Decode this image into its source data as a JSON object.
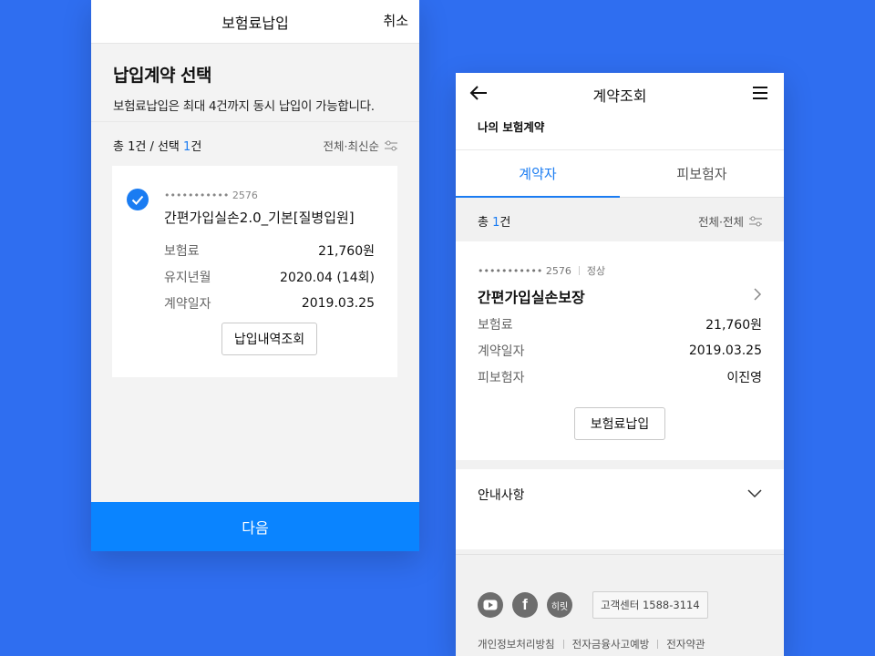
{
  "left": {
    "header_title": "보험료납입",
    "cancel_label": "취소",
    "heading": "납입계약 선택",
    "description": "보험료납입은 최대 4건까지 동시 납입이 가능합니다.",
    "count_prefix": "총 1건 / 선택 ",
    "count_selected": "1",
    "count_suffix": "건",
    "sort_label": "전체·최신순",
    "card": {
      "account": "••••••••••• 2576",
      "product": "간편가입실손2.0_기본[질병입원]",
      "rows": [
        {
          "label": "보험료",
          "value": "21,760원"
        },
        {
          "label": "유지년월",
          "value": "2020.04 (14회)"
        },
        {
          "label": "계약일자",
          "value": "2019.03.25"
        }
      ],
      "history_button": "납입내역조회"
    },
    "next_button": "다음"
  },
  "right": {
    "header_title": "계약조회",
    "subtitle": "나의 보험계약",
    "tabs": [
      {
        "label": "계약자",
        "active": true
      },
      {
        "label": "피보험자",
        "active": false
      }
    ],
    "count_prefix": "총 ",
    "count_value": "1",
    "count_suffix": "건",
    "sort_label": "전체·전체",
    "card": {
      "account": "••••••••••• 2576",
      "status": "정상",
      "product": "간편가입실손보장",
      "rows": [
        {
          "label": "보험료",
          "value": "21,760원"
        },
        {
          "label": "계약일자",
          "value": "2019.03.25"
        },
        {
          "label": "피보험자",
          "value": "이진영"
        }
      ],
      "pay_button": "보험료납입"
    },
    "notice_label": "안내사항",
    "footer": {
      "social_icons": [
        "youtube-icon",
        "facebook-icon",
        "hirit-icon"
      ],
      "hirit_text": "히릿",
      "customer_center": "고객센터 1588-3114",
      "links": [
        "개인정보처리방침",
        "전자금융사고예방",
        "전자약관"
      ]
    }
  },
  "colors": {
    "background": "#2f6ef0",
    "accent": "#1a7cf2",
    "next_button": "#0a84ff"
  }
}
